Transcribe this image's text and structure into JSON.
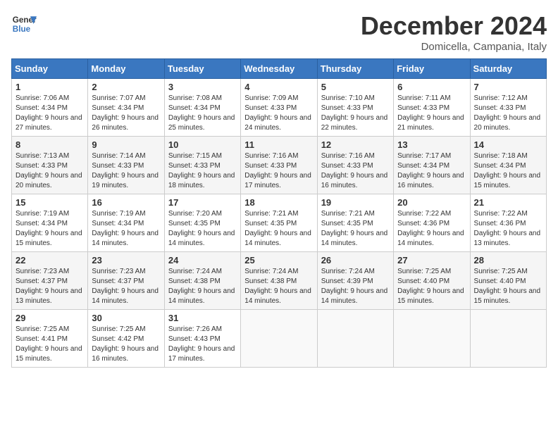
{
  "logo": {
    "line1": "General",
    "line2": "Blue"
  },
  "title": "December 2024",
  "location": "Domicella, Campania, Italy",
  "headers": [
    "Sunday",
    "Monday",
    "Tuesday",
    "Wednesday",
    "Thursday",
    "Friday",
    "Saturday"
  ],
  "weeks": [
    [
      {
        "day": "1",
        "sunrise": "Sunrise: 7:06 AM",
        "sunset": "Sunset: 4:34 PM",
        "daylight": "Daylight: 9 hours and 27 minutes."
      },
      {
        "day": "2",
        "sunrise": "Sunrise: 7:07 AM",
        "sunset": "Sunset: 4:34 PM",
        "daylight": "Daylight: 9 hours and 26 minutes."
      },
      {
        "day": "3",
        "sunrise": "Sunrise: 7:08 AM",
        "sunset": "Sunset: 4:34 PM",
        "daylight": "Daylight: 9 hours and 25 minutes."
      },
      {
        "day": "4",
        "sunrise": "Sunrise: 7:09 AM",
        "sunset": "Sunset: 4:33 PM",
        "daylight": "Daylight: 9 hours and 24 minutes."
      },
      {
        "day": "5",
        "sunrise": "Sunrise: 7:10 AM",
        "sunset": "Sunset: 4:33 PM",
        "daylight": "Daylight: 9 hours and 22 minutes."
      },
      {
        "day": "6",
        "sunrise": "Sunrise: 7:11 AM",
        "sunset": "Sunset: 4:33 PM",
        "daylight": "Daylight: 9 hours and 21 minutes."
      },
      {
        "day": "7",
        "sunrise": "Sunrise: 7:12 AM",
        "sunset": "Sunset: 4:33 PM",
        "daylight": "Daylight: 9 hours and 20 minutes."
      }
    ],
    [
      {
        "day": "8",
        "sunrise": "Sunrise: 7:13 AM",
        "sunset": "Sunset: 4:33 PM",
        "daylight": "Daylight: 9 hours and 20 minutes."
      },
      {
        "day": "9",
        "sunrise": "Sunrise: 7:14 AM",
        "sunset": "Sunset: 4:33 PM",
        "daylight": "Daylight: 9 hours and 19 minutes."
      },
      {
        "day": "10",
        "sunrise": "Sunrise: 7:15 AM",
        "sunset": "Sunset: 4:33 PM",
        "daylight": "Daylight: 9 hours and 18 minutes."
      },
      {
        "day": "11",
        "sunrise": "Sunrise: 7:16 AM",
        "sunset": "Sunset: 4:33 PM",
        "daylight": "Daylight: 9 hours and 17 minutes."
      },
      {
        "day": "12",
        "sunrise": "Sunrise: 7:16 AM",
        "sunset": "Sunset: 4:33 PM",
        "daylight": "Daylight: 9 hours and 16 minutes."
      },
      {
        "day": "13",
        "sunrise": "Sunrise: 7:17 AM",
        "sunset": "Sunset: 4:34 PM",
        "daylight": "Daylight: 9 hours and 16 minutes."
      },
      {
        "day": "14",
        "sunrise": "Sunrise: 7:18 AM",
        "sunset": "Sunset: 4:34 PM",
        "daylight": "Daylight: 9 hours and 15 minutes."
      }
    ],
    [
      {
        "day": "15",
        "sunrise": "Sunrise: 7:19 AM",
        "sunset": "Sunset: 4:34 PM",
        "daylight": "Daylight: 9 hours and 15 minutes."
      },
      {
        "day": "16",
        "sunrise": "Sunrise: 7:19 AM",
        "sunset": "Sunset: 4:34 PM",
        "daylight": "Daylight: 9 hours and 14 minutes."
      },
      {
        "day": "17",
        "sunrise": "Sunrise: 7:20 AM",
        "sunset": "Sunset: 4:35 PM",
        "daylight": "Daylight: 9 hours and 14 minutes."
      },
      {
        "day": "18",
        "sunrise": "Sunrise: 7:21 AM",
        "sunset": "Sunset: 4:35 PM",
        "daylight": "Daylight: 9 hours and 14 minutes."
      },
      {
        "day": "19",
        "sunrise": "Sunrise: 7:21 AM",
        "sunset": "Sunset: 4:35 PM",
        "daylight": "Daylight: 9 hours and 14 minutes."
      },
      {
        "day": "20",
        "sunrise": "Sunrise: 7:22 AM",
        "sunset": "Sunset: 4:36 PM",
        "daylight": "Daylight: 9 hours and 14 minutes."
      },
      {
        "day": "21",
        "sunrise": "Sunrise: 7:22 AM",
        "sunset": "Sunset: 4:36 PM",
        "daylight": "Daylight: 9 hours and 13 minutes."
      }
    ],
    [
      {
        "day": "22",
        "sunrise": "Sunrise: 7:23 AM",
        "sunset": "Sunset: 4:37 PM",
        "daylight": "Daylight: 9 hours and 13 minutes."
      },
      {
        "day": "23",
        "sunrise": "Sunrise: 7:23 AM",
        "sunset": "Sunset: 4:37 PM",
        "daylight": "Daylight: 9 hours and 14 minutes."
      },
      {
        "day": "24",
        "sunrise": "Sunrise: 7:24 AM",
        "sunset": "Sunset: 4:38 PM",
        "daylight": "Daylight: 9 hours and 14 minutes."
      },
      {
        "day": "25",
        "sunrise": "Sunrise: 7:24 AM",
        "sunset": "Sunset: 4:38 PM",
        "daylight": "Daylight: 9 hours and 14 minutes."
      },
      {
        "day": "26",
        "sunrise": "Sunrise: 7:24 AM",
        "sunset": "Sunset: 4:39 PM",
        "daylight": "Daylight: 9 hours and 14 minutes."
      },
      {
        "day": "27",
        "sunrise": "Sunrise: 7:25 AM",
        "sunset": "Sunset: 4:40 PM",
        "daylight": "Daylight: 9 hours and 15 minutes."
      },
      {
        "day": "28",
        "sunrise": "Sunrise: 7:25 AM",
        "sunset": "Sunset: 4:40 PM",
        "daylight": "Daylight: 9 hours and 15 minutes."
      }
    ],
    [
      {
        "day": "29",
        "sunrise": "Sunrise: 7:25 AM",
        "sunset": "Sunset: 4:41 PM",
        "daylight": "Daylight: 9 hours and 15 minutes."
      },
      {
        "day": "30",
        "sunrise": "Sunrise: 7:25 AM",
        "sunset": "Sunset: 4:42 PM",
        "daylight": "Daylight: 9 hours and 16 minutes."
      },
      {
        "day": "31",
        "sunrise": "Sunrise: 7:26 AM",
        "sunset": "Sunset: 4:43 PM",
        "daylight": "Daylight: 9 hours and 17 minutes."
      },
      null,
      null,
      null,
      null
    ]
  ]
}
